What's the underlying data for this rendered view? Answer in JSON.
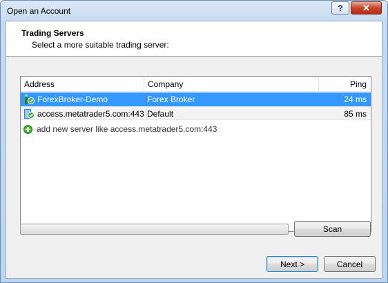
{
  "window": {
    "title": "Open an Account",
    "help_label": "?",
    "close_label": "✕"
  },
  "header": {
    "title": "Trading Servers",
    "subtitle": "Select a more suitable trading server:"
  },
  "table": {
    "columns": [
      "Address",
      "Company",
      "Ping"
    ],
    "rows": [
      {
        "address": "ForexBroker-Demo",
        "company": "Forex Broker",
        "ping": "24 ms",
        "selected": true,
        "icon": "server-icon"
      },
      {
        "address": "access.metatrader5.com:443",
        "company": "Default",
        "ping": "85 ms",
        "selected": false,
        "icon": "server-icon"
      }
    ],
    "add_server_text": "add new server like access.metatrader5.com:443",
    "add_icon": "add-icon"
  },
  "buttons": {
    "scan": "Scan",
    "next": "Next >",
    "cancel": "Cancel"
  },
  "colors": {
    "selection": "#3399ff",
    "add_icon": "#3fae2a"
  }
}
